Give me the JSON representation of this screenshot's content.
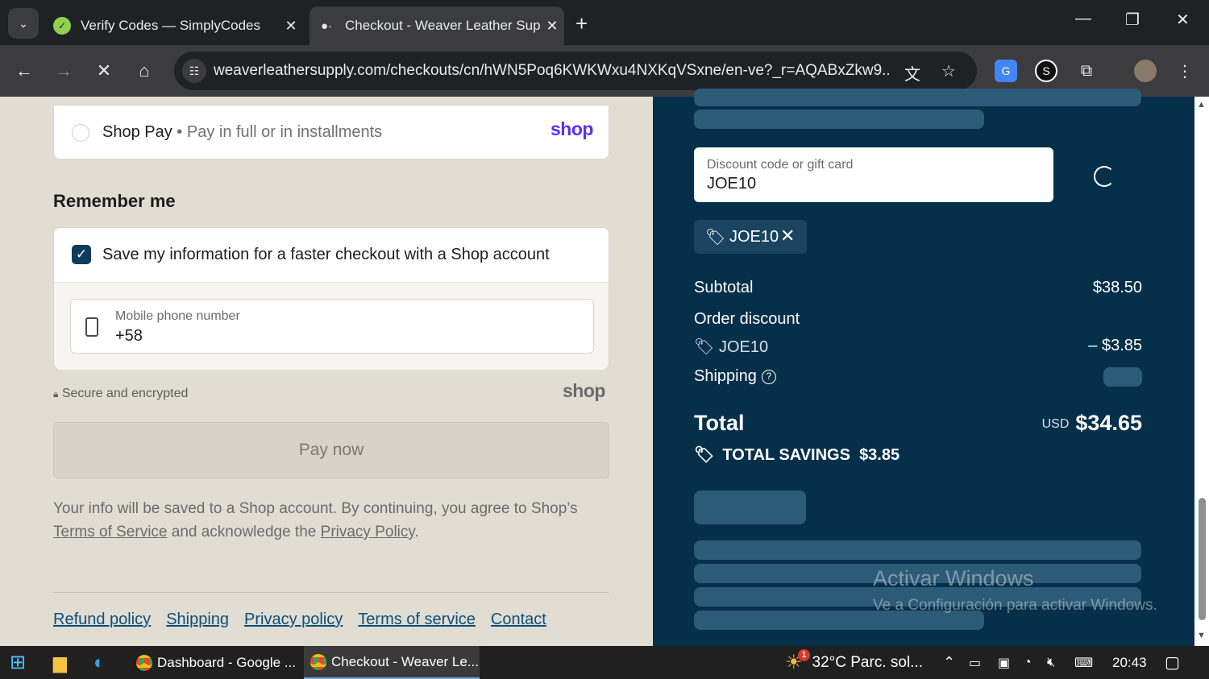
{
  "browser": {
    "tabs": [
      {
        "title": "Verify Codes — SimplyCodes",
        "active": false
      },
      {
        "title": "Checkout - Weaver Leather Sup",
        "active": true
      }
    ],
    "url": "weaverleathersupply.com/checkouts/cn/hWN5Poq6KWKWxu4NXKqVSxne/en-ve?_r=AQABxZkw9..."
  },
  "left": {
    "shop_pay": {
      "label": "Shop Pay",
      "separator": " • ",
      "sub": "Pay in full or in installments",
      "logo": "shop"
    },
    "remember_me": {
      "title": "Remember me",
      "save_label": "Save my information for a faster checkout with a Shop account",
      "checked": true,
      "phone_label": "Mobile phone number",
      "phone_value": "+58"
    },
    "secure_text": "Secure and encrypted",
    "shop_logo": "shop",
    "pay_button": "Pay now",
    "legal": {
      "text1": "Your info will be saved to a Shop account. By continuing, you agree to Shop’s",
      "terms_link": "Terms of Service",
      "text2": "and acknowledge the",
      "privacy_link": "Privacy Policy",
      "text3": "."
    },
    "footer_links": [
      "Refund policy",
      "Shipping",
      "Privacy policy",
      "Terms of service",
      "Contact"
    ]
  },
  "summary": {
    "discount_label": "Discount code or gift card",
    "discount_value": "JOE10",
    "applied_code": "JOE10",
    "subtotal_label": "Subtotal",
    "subtotal_value": "$38.50",
    "order_discount_label": "Order discount",
    "discount_code": "JOE10",
    "discount_amount": "– $3.85",
    "shipping_label": "Shipping",
    "total_label": "Total",
    "currency": "USD",
    "total_value": "$34.65",
    "savings_label": "TOTAL SAVINGS",
    "savings_value": "$3.85"
  },
  "watermark": {
    "line1": "Activar Windows",
    "line2": "Ve a Configuración para activar Windows."
  },
  "taskbar": {
    "apps": [
      {
        "label": "Dashboard - Google ...",
        "active": false
      },
      {
        "label": "Checkout - Weaver Le...",
        "active": true
      }
    ],
    "weather": "32°C  Parc. sol...",
    "weather_badge": "1",
    "time": "20:43"
  }
}
